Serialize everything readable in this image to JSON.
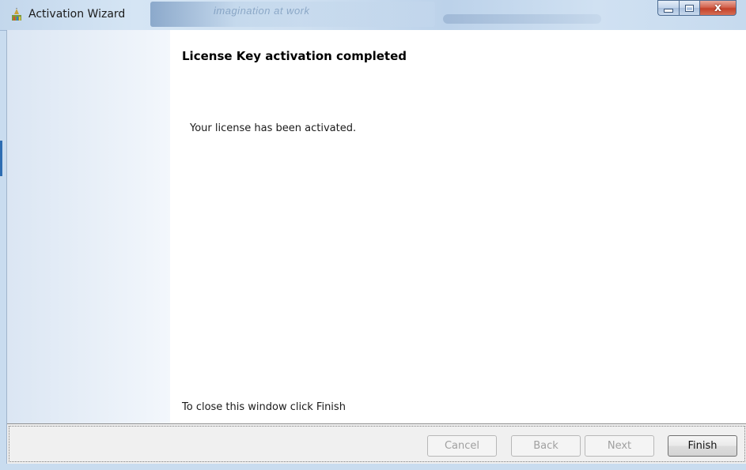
{
  "window": {
    "title": "Activation Wizard",
    "background_text": "imagination at work",
    "icons": {
      "app": "wizard-app-icon",
      "minimize": "minimize-icon",
      "maximize": "maximize-icon",
      "close": "close-icon"
    },
    "close_glyph": "x"
  },
  "content": {
    "heading": "License Key activation completed",
    "message": "Your license has been activated.",
    "closing_hint": "To close this window click Finish"
  },
  "buttons": {
    "cancel": "Cancel",
    "back": "Back",
    "next": "Next",
    "finish": "Finish"
  },
  "colors": {
    "titlebar": "#c9dcef",
    "close_button": "#c4412a",
    "side_panel": "#dbe6f3",
    "disabled_text": "#a0a0a0"
  }
}
